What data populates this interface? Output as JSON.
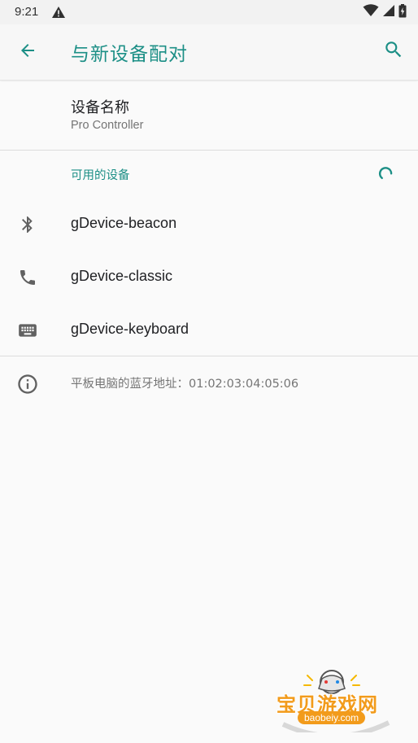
{
  "status_bar": {
    "time": "9:21",
    "icons": [
      "alert-icon",
      "wifi-icon",
      "signal-icon",
      "battery-icon"
    ]
  },
  "app_bar": {
    "title": "与新设备配对",
    "back_icon": "arrow-back-icon",
    "search_icon": "search-icon"
  },
  "device_name": {
    "title": "设备名称",
    "value": "Pro Controller"
  },
  "available_devices": {
    "header": "可用的设备",
    "items": [
      {
        "icon": "bluetooth-icon",
        "label": "gDevice-beacon"
      },
      {
        "icon": "phone-icon",
        "label": "gDevice-classic"
      },
      {
        "icon": "keyboard-icon",
        "label": "gDevice-keyboard"
      }
    ]
  },
  "info": {
    "icon": "info-icon",
    "text": "平板电脑的蓝牙地址：01:02:03:04:05:06"
  },
  "watermark": {
    "text": "宝贝游戏网",
    "url": "baobeiy.com"
  },
  "colors": {
    "accent": "#1c8f86",
    "background": "#fafafa",
    "secondary_text": "#757575",
    "watermark": "#f29b1b"
  }
}
